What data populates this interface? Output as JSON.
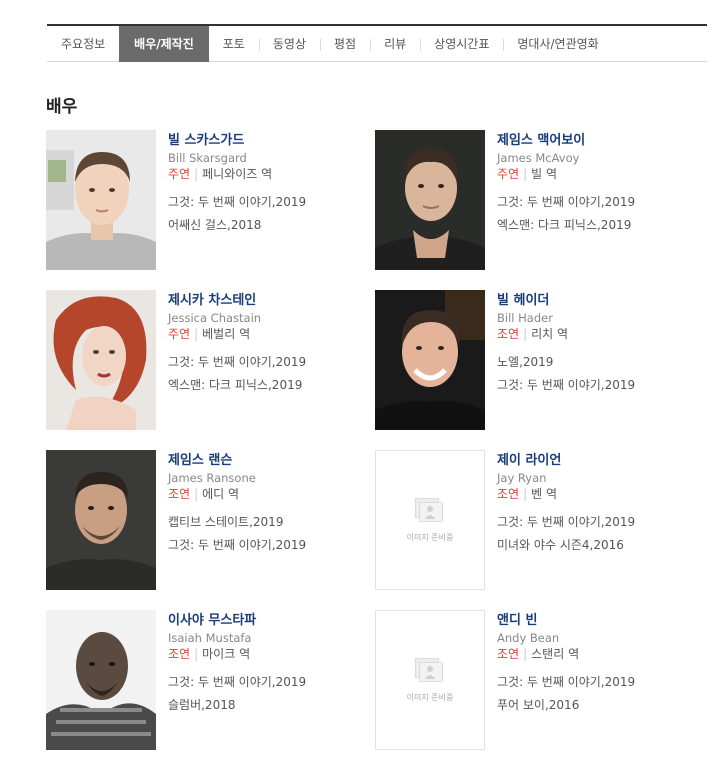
{
  "tabs": [
    {
      "label": "주요정보",
      "active": false
    },
    {
      "label": "배우/제작진",
      "active": true
    },
    {
      "label": "포토",
      "active": false
    },
    {
      "label": "동영상",
      "active": false
    },
    {
      "label": "평점",
      "active": false
    },
    {
      "label": "리뷰",
      "active": false
    },
    {
      "label": "상영시간표",
      "active": false
    },
    {
      "label": "명대사/연관영화",
      "active": false
    }
  ],
  "section_title": "배우",
  "placeholder_text": "이미지 준비중",
  "actors": [
    {
      "ko": "빌 스카스가드",
      "en": "Bill Skarsgard",
      "type": "주연",
      "role": "페니와이즈 역",
      "photo": "portrait",
      "films": [
        "그것: 두 번째 이야기,2019",
        "어쌔신 걸스,2018"
      ]
    },
    {
      "ko": "제임스 맥어보이",
      "en": "James McAvoy",
      "type": "주연",
      "role": "빌 역",
      "photo": "portrait",
      "films": [
        "그것: 두 번째 이야기,2019",
        "엑스맨: 다크 피닉스,2019"
      ]
    },
    {
      "ko": "제시카 차스테인",
      "en": "Jessica Chastain",
      "type": "주연",
      "role": "베벌리 역",
      "photo": "portrait",
      "films": [
        "그것: 두 번째 이야기,2019",
        "엑스맨: 다크 피닉스,2019"
      ]
    },
    {
      "ko": "빌 헤이더",
      "en": "Bill Hader",
      "type": "조연",
      "role": "리치 역",
      "photo": "portrait",
      "films": [
        "노엘,2019",
        "그것: 두 번째 이야기,2019"
      ]
    },
    {
      "ko": "제임스 랜슨",
      "en": "James Ransone",
      "type": "조연",
      "role": "에디 역",
      "photo": "portrait",
      "films": [
        "캡티브 스테이트,2019",
        "그것: 두 번째 이야기,2019"
      ]
    },
    {
      "ko": "제이 라이언",
      "en": "Jay Ryan",
      "type": "조연",
      "role": "벤 역",
      "photo": "placeholder",
      "films": [
        "그것: 두 번째 이야기,2019",
        "미녀와 야수 시즌4,2016"
      ]
    },
    {
      "ko": "이사야 무스타파",
      "en": "Isaiah Mustafa",
      "type": "조연",
      "role": "마이크 역",
      "photo": "portrait",
      "films": [
        "그것: 두 번째 이야기,2019",
        "슬럼버,2018"
      ]
    },
    {
      "ko": "앤디 빈",
      "en": "Andy Bean",
      "type": "조연",
      "role": "스탠리 역",
      "photo": "placeholder",
      "films": [
        "그것: 두 번째 이야기,2019",
        "푸어 보이,2016"
      ]
    }
  ],
  "colors": {
    "name": "#1a3c7a",
    "role_type": "#d9442b",
    "active_tab": "#6b6b6b"
  }
}
